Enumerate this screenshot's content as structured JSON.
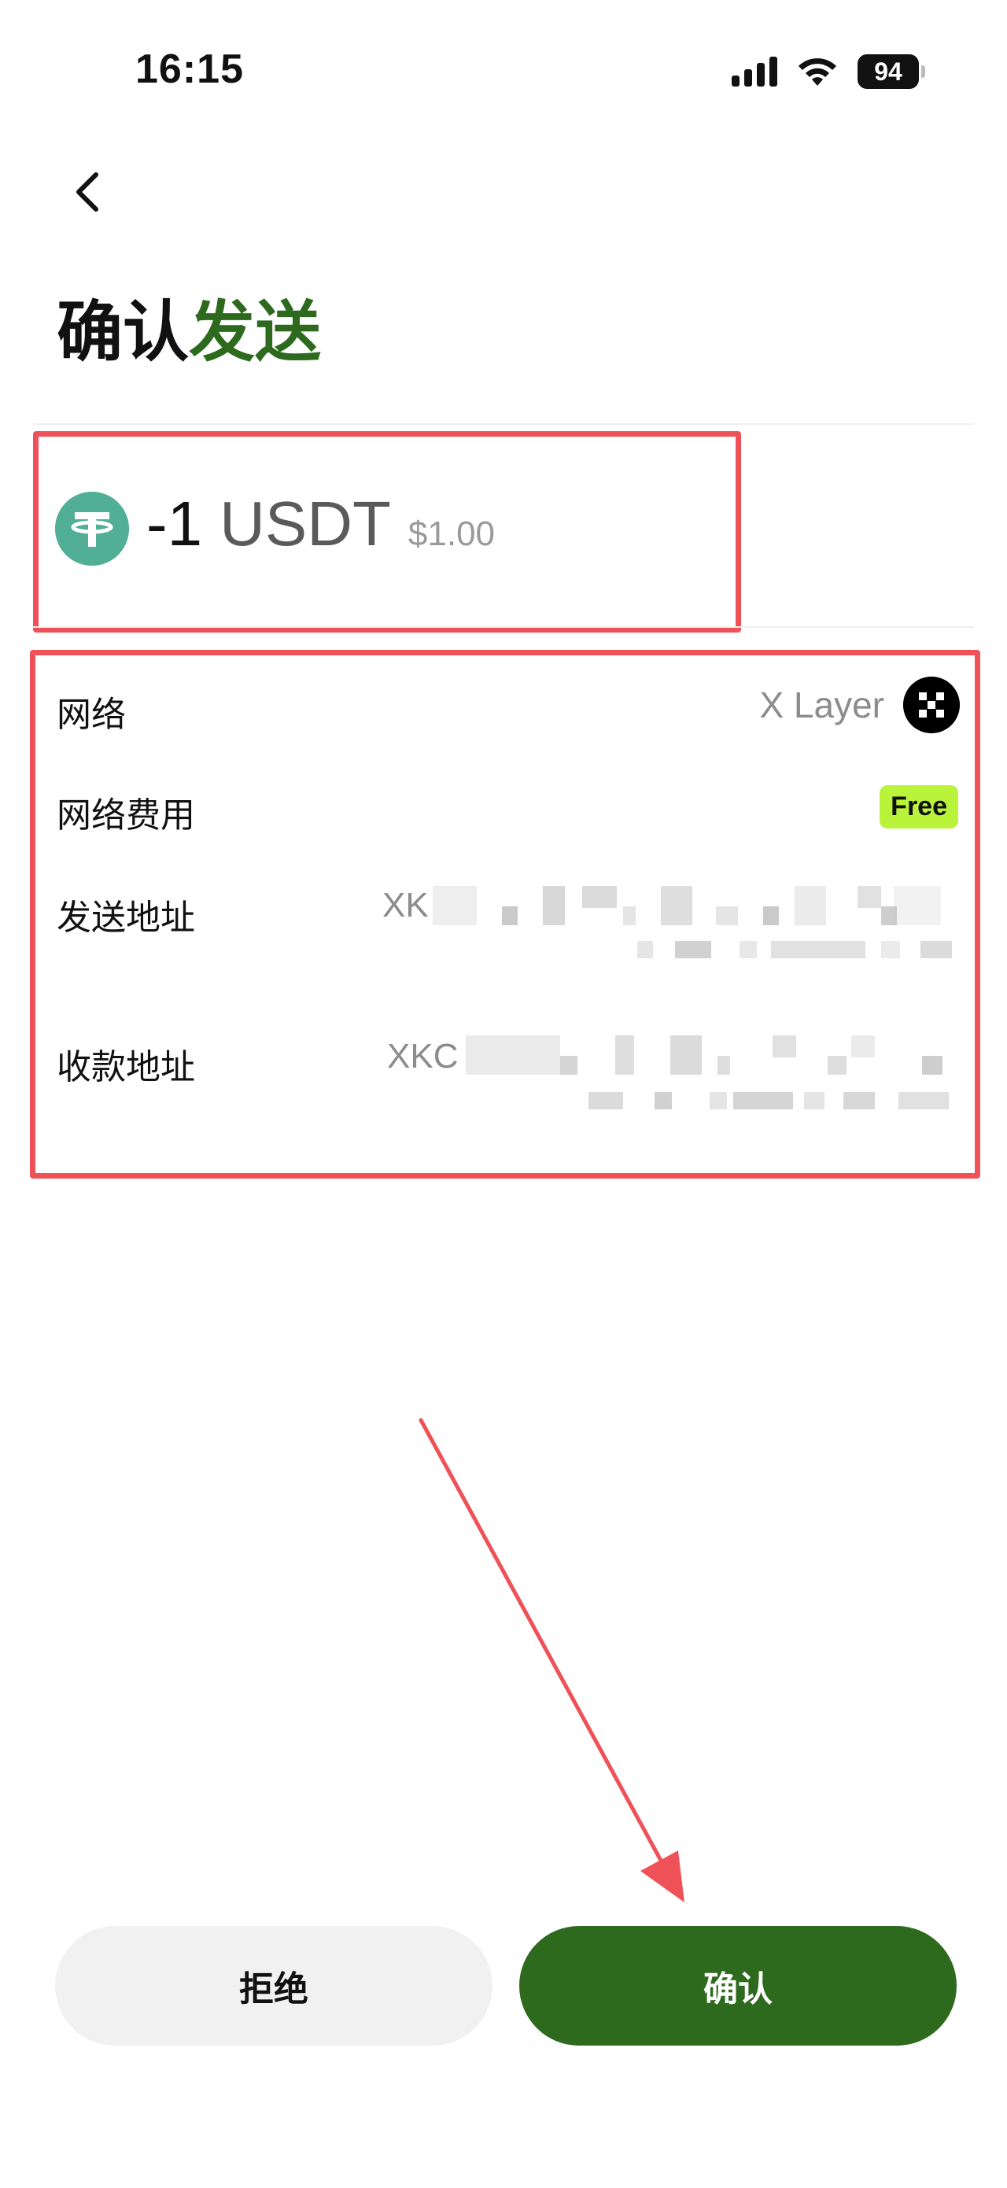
{
  "status_bar": {
    "time": "16:15",
    "battery": "94"
  },
  "header": {
    "back_icon": "chevron-left-icon",
    "title_prefix": "确认",
    "title_suffix": "发送"
  },
  "amount": {
    "token_icon": "tether-icon",
    "value": "-1",
    "unit": "USDT",
    "fiat": "$1.00"
  },
  "details": {
    "network_label": "网络",
    "network_value": "X Layer",
    "network_icon": "okx-logo-icon",
    "fee_label": "网络费用",
    "fee_value": "Free",
    "from_label": "发送地址",
    "from_value": "XK",
    "to_label": "收款地址",
    "to_value": "XKC"
  },
  "actions": {
    "reject_label": "拒绝",
    "confirm_label": "确认"
  },
  "colors": {
    "accent_green": "#2d6a1e",
    "highlight_red": "#ef5158",
    "free_badge": "#b9f43a",
    "tether": "#50af95"
  }
}
